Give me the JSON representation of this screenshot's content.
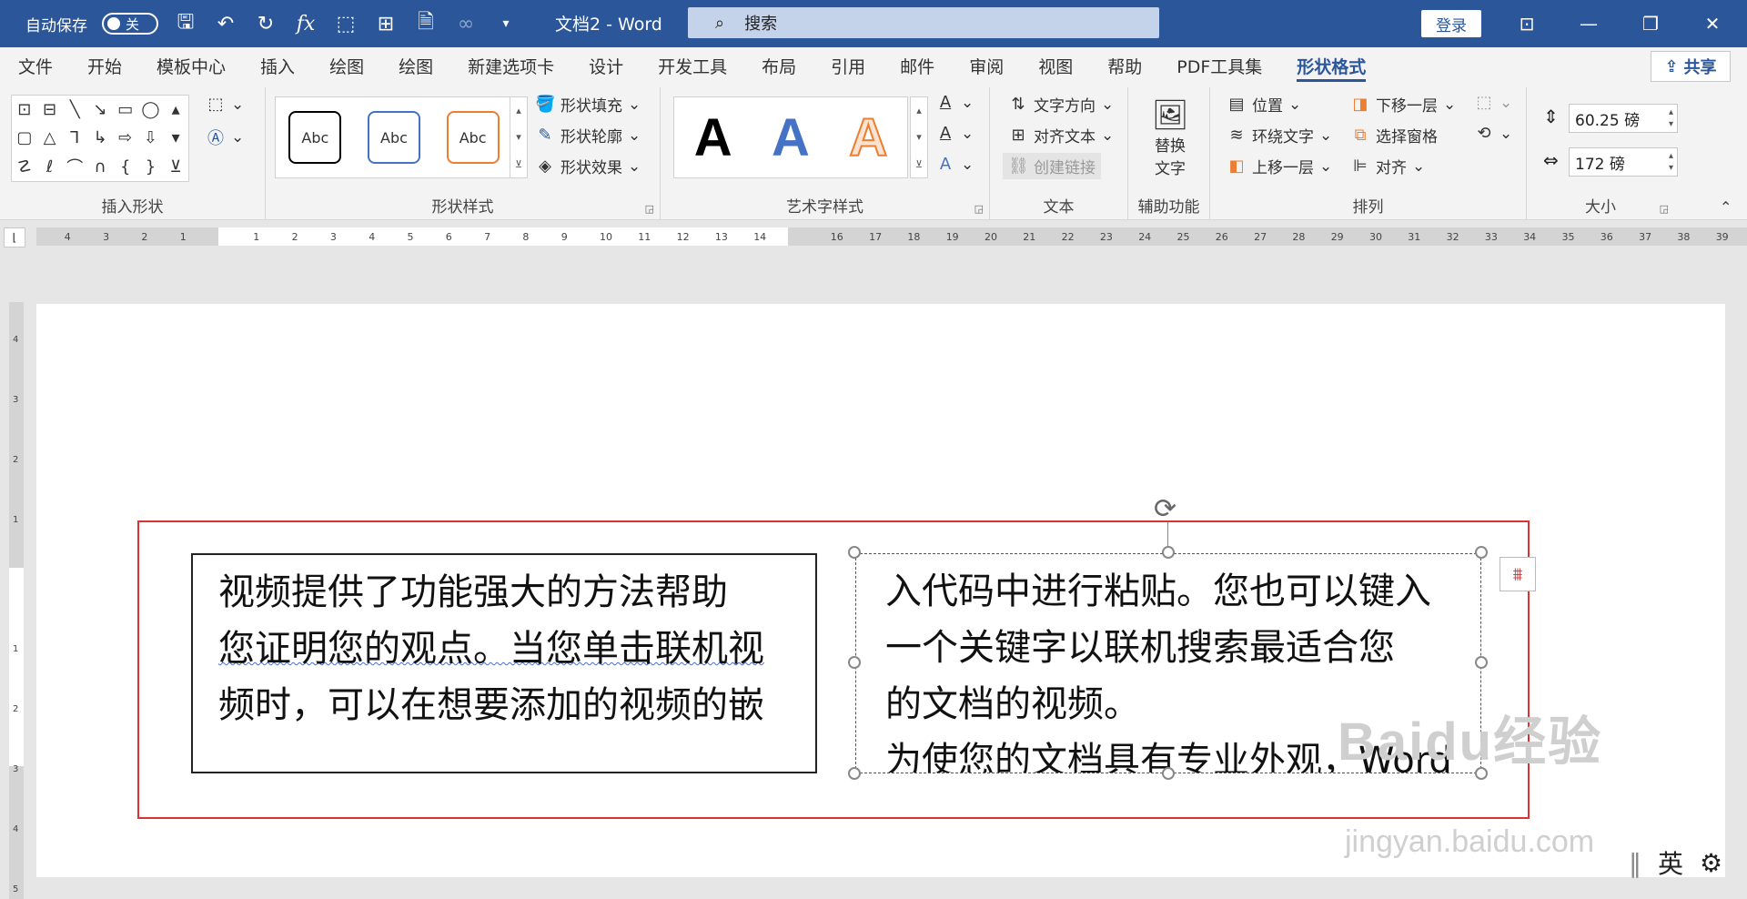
{
  "titlebar": {
    "autosave_label": "自动保存",
    "autosave_state": "关",
    "doc_name": "文档2  -  Word",
    "search_placeholder": "搜索",
    "login_label": "登录",
    "icons": [
      "save-icon",
      "undo-icon",
      "redo-icon",
      "formula-icon",
      "select-icon",
      "org-chart-icon",
      "document-icon",
      "infinity-icon",
      "customize-icon"
    ]
  },
  "tabs": [
    "文件",
    "开始",
    "模板中心",
    "插入",
    "绘图",
    "绘图",
    "新建选项卡",
    "设计",
    "开发工具",
    "布局",
    "引用",
    "邮件",
    "审阅",
    "视图",
    "帮助",
    "PDF工具集",
    "形状格式"
  ],
  "active_tab": "形状格式",
  "share_label": "共享",
  "ribbon": {
    "insert_shapes": {
      "label": "插入形状"
    },
    "shape_styles": {
      "label": "形状样式",
      "preview_text": "Abc",
      "fill": "形状填充",
      "outline": "形状轮廓",
      "effects": "形状效果"
    },
    "wordart": {
      "label": "艺术字样式",
      "preview_letter": "A"
    },
    "text": {
      "label": "文本",
      "direction": "文字方向",
      "align": "对齐文本",
      "link": "创建链接"
    },
    "accessibility": {
      "label": "辅助功能",
      "alt_text_line1": "替换",
      "alt_text_line2": "文字"
    },
    "arrange": {
      "label": "排列",
      "position": "位置",
      "wrap": "环绕文字",
      "forward": "上移一层",
      "backward": "下移一层",
      "selection_pane": "选择窗格",
      "align": "对齐"
    },
    "size": {
      "label": "大小",
      "height": "60.25 磅",
      "width": "172 磅"
    }
  },
  "ruler": {
    "h_left": [
      "4",
      "3",
      "2",
      "1"
    ],
    "h_right": [
      "1",
      "2",
      "3",
      "4",
      "5",
      "6",
      "7",
      "8",
      "9",
      "10",
      "11",
      "12",
      "13",
      "14",
      "16",
      "17",
      "18",
      "19",
      "20",
      "21",
      "22",
      "23",
      "24",
      "25",
      "26",
      "27",
      "28",
      "29",
      "30",
      "31",
      "32",
      "33",
      "34",
      "35",
      "36",
      "37",
      "38",
      "39",
      "4"
    ],
    "v_top": [
      "4",
      "3",
      "2",
      "1"
    ],
    "v_bottom": [
      "1",
      "2",
      "3",
      "4",
      "5"
    ]
  },
  "document": {
    "textbox1_lines": [
      "视频提供了功能强大的方法帮助",
      "您证明您的观点。当您单击联机视",
      "频时，可以在想要添加的视频的嵌"
    ],
    "textbox2_lines": [
      "入代码中进行粘贴。您也可以键入",
      "一个关键字以联机搜索最适合您",
      "的文档的视频。",
      "为使您的文档具有专业外观，Word"
    ]
  },
  "watermark": {
    "main": "Baidu经验",
    "sub": "jingyan.baidu.com"
  },
  "ime": {
    "lang": "英"
  },
  "colors": {
    "title_bar": "#2b579a",
    "accent": "#2b579a",
    "selection_frame": "#e03030"
  }
}
